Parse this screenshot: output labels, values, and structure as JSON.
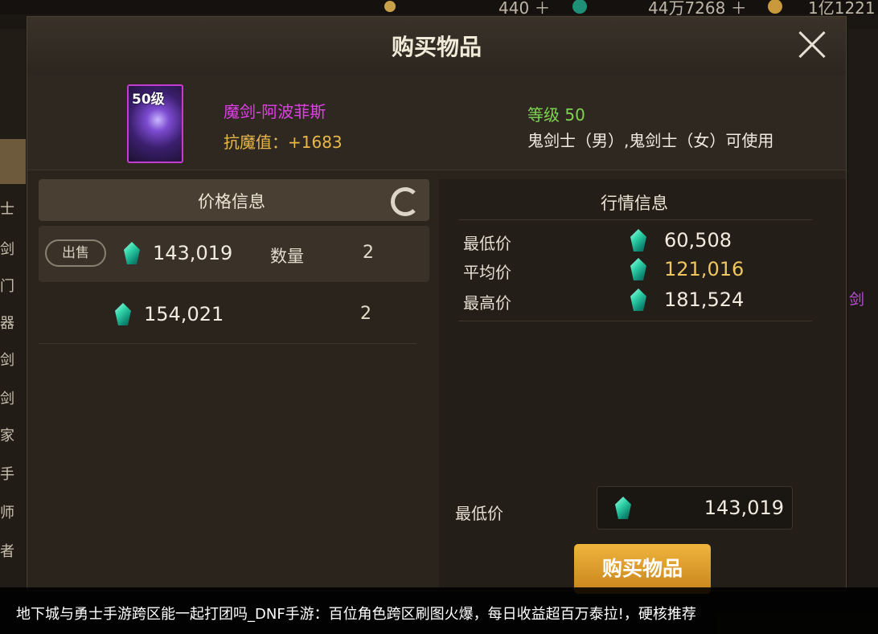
{
  "topbar": {
    "currencies": [
      {
        "value": "440 ＋",
        "icon": "moon-icon"
      },
      {
        "value": "44万7268 ＋",
        "icon": "gem-icon"
      },
      {
        "value": "1亿1221",
        "icon": "gold-coin-icon"
      }
    ]
  },
  "side_tabs": [
    "士",
    "剑",
    "门",
    "器",
    "剑",
    "剑",
    "家",
    "手",
    "师",
    "者"
  ],
  "right_partial": "剑",
  "dialog": {
    "title": "购买物品",
    "item": {
      "level_badge": "50级",
      "name": "魔剑-阿波菲斯",
      "stat": "抗魔值：+1683",
      "requirement": "等级 50",
      "usable_by": "鬼剑士（男）,鬼剑士（女）可使用"
    },
    "price_panel": {
      "title": "价格信息",
      "listings": [
        {
          "action": "出售",
          "price": "143,019",
          "qty_label": "数量",
          "qty": "2"
        },
        {
          "price": "154,021",
          "qty": "2"
        }
      ]
    },
    "market_panel": {
      "title": "行情信息",
      "rows": [
        {
          "label": "最低价",
          "value": "60,508"
        },
        {
          "label": "平均价",
          "value": "121,016"
        },
        {
          "label": "最高价",
          "value": "181,524"
        }
      ],
      "bottom_label": "最低价",
      "bottom_value": "143,019",
      "buy_button": "购买物品"
    },
    "colors": {
      "item_name": "#e040e8",
      "requirement": "#7fd454",
      "average": "#f0c660",
      "gem": "#2fd2a7",
      "buy": "#e4a02c"
    }
  },
  "caption": "地下城与勇士手游跨区能一起打团吗_DNF手游：百位角色跨区刷图火爆，每日收益超百万泰拉!，硬核推荐"
}
